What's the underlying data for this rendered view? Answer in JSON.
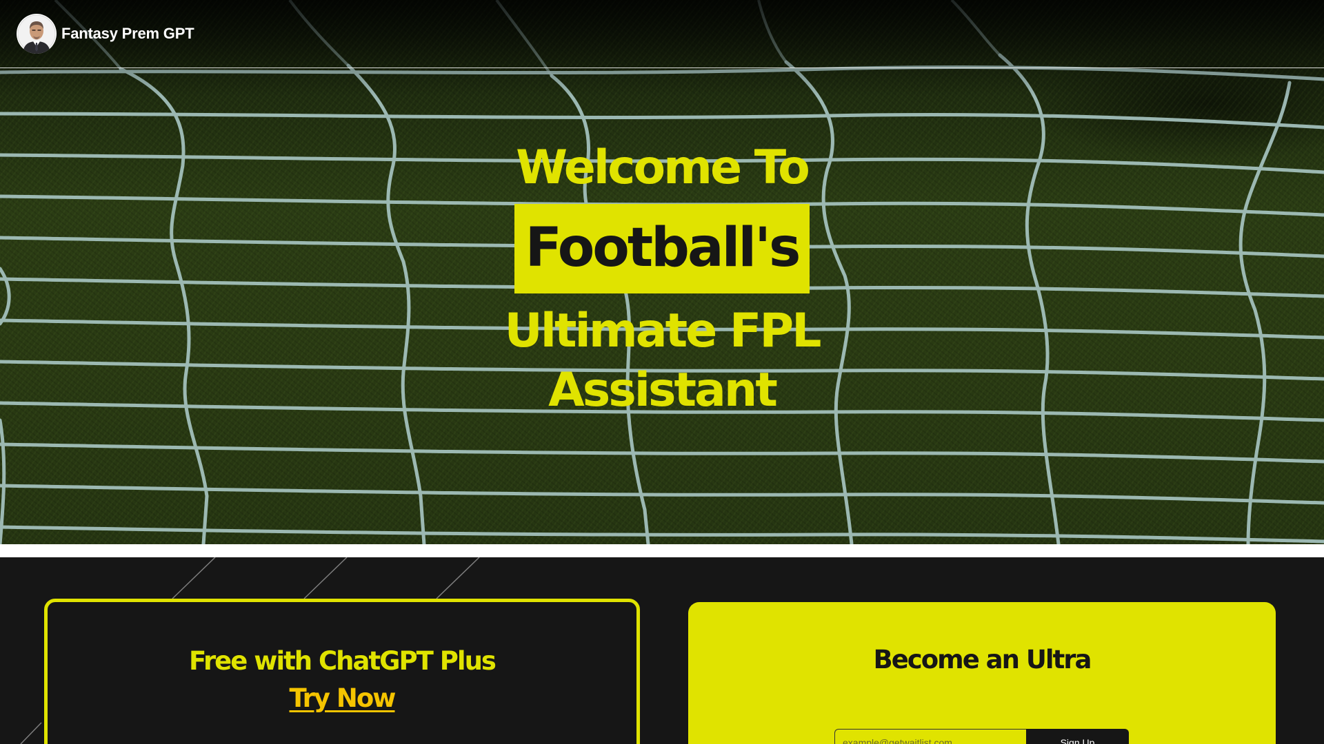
{
  "navbar": {
    "brand_name": "Fantasy Prem GPT",
    "avatar_icon": "manager-portrait-icon"
  },
  "hero": {
    "line_1": "Welcome To",
    "highlight": "Football's",
    "line_3": "Ultimate FPL",
    "line_4": "Assistant"
  },
  "free_card": {
    "title": "Free with ChatGPT Plus",
    "link_label": "Try Now"
  },
  "ultra_card": {
    "title": "Become an Ultra",
    "email_placeholder": "example@getwaitlist.com",
    "email_value": "",
    "signup_label": "Sign Up"
  },
  "colors": {
    "accent_yellow": "#e0e300",
    "link_gold": "#f5c400",
    "dark": "#161616",
    "white": "#ffffff"
  }
}
